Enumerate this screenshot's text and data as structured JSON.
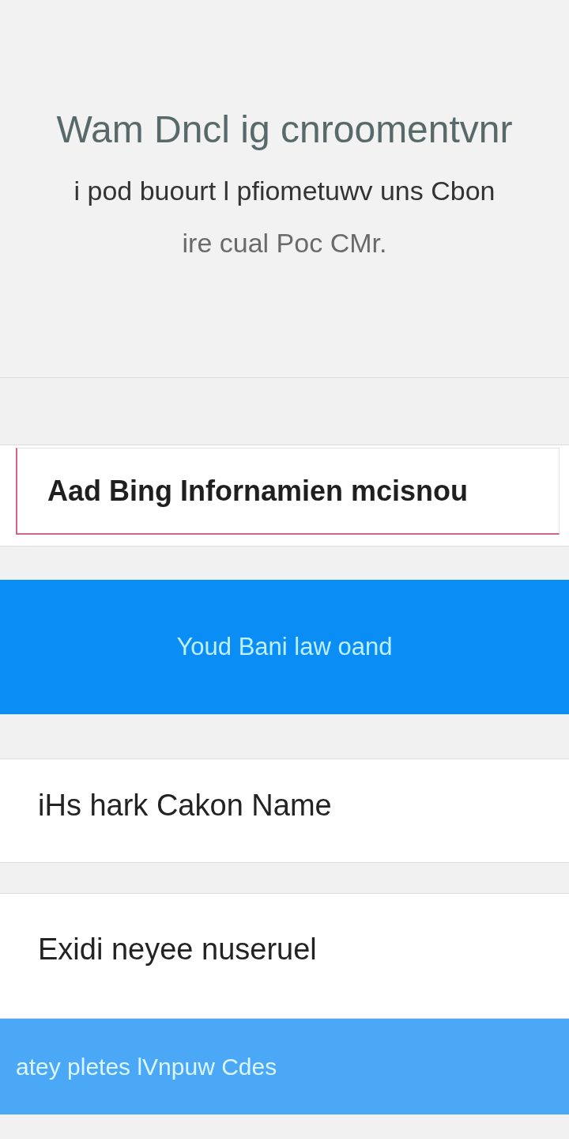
{
  "header": {
    "title": "Wam Dncl ig cnroomentvnr",
    "subtitle_lines": [
      "i pod buourt l pfiometuwv uns Cbon",
      "ire cual Poc CMr."
    ]
  },
  "input": {
    "value": "Aad Bing Infornamien mcisnou",
    "focused": true
  },
  "primary_button": {
    "label": "Youd Bani law oand"
  },
  "rows": [
    {
      "label": "iHs hark Cakon Name"
    },
    {
      "label": "Exidi neyee nuseruel"
    }
  ],
  "secondary_button": {
    "label": "atey pletes lVnpuw Cdes"
  }
}
